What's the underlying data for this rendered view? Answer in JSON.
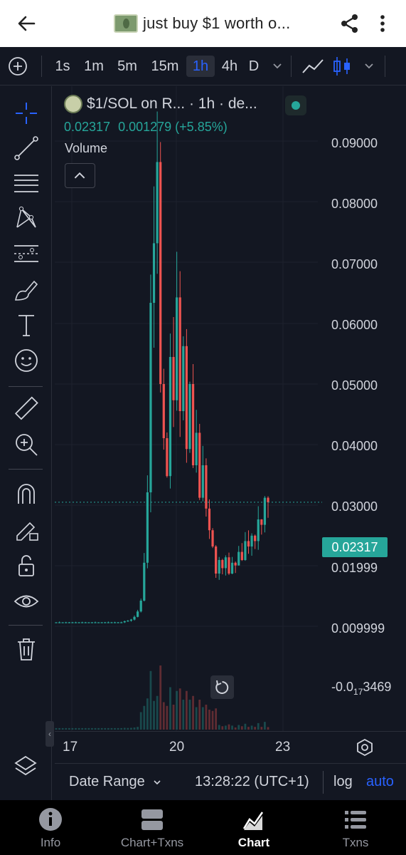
{
  "header": {
    "title": "just buy $1 worth o...",
    "back_icon": "arrow-left-icon",
    "share_icon": "share-icon",
    "menu_icon": "more-vertical-icon"
  },
  "toolbar": {
    "intervals": [
      "1s",
      "1m",
      "5m",
      "15m",
      "1h",
      "4h",
      "D"
    ],
    "active_interval": "1h"
  },
  "legend": {
    "symbol": "$1/SOL on R... · 1h · de...",
    "price": "0.02317",
    "change": "0.001279 (+5.85%)",
    "volume_label": "Volume"
  },
  "price_axis": {
    "labels": [
      "0.09000",
      "0.08000",
      "0.07000",
      "0.06000",
      "0.05000",
      "0.04000",
      "0.03000",
      "0.01999",
      "0.009999"
    ],
    "last_price": "0.02317",
    "low_label_main": "-0.0",
    "low_label_sub": "17",
    "low_label_tail": "3469"
  },
  "time_axis": {
    "labels": [
      "17",
      "20",
      "23"
    ]
  },
  "bottom_bar": {
    "date_range": "Date Range",
    "time": "13:28:22 (UTC+1)",
    "log": "log",
    "auto": "auto"
  },
  "nav": {
    "items": [
      {
        "label": "Info",
        "icon": "info-icon"
      },
      {
        "label": "Chart+Txns",
        "icon": "split-icon"
      },
      {
        "label": "Chart",
        "icon": "chart-icon"
      },
      {
        "label": "Txns",
        "icon": "list-icon"
      }
    ],
    "active": "Chart"
  },
  "colors": {
    "up": "#26a69a",
    "down": "#ef5350",
    "accent": "#2962ff",
    "background": "#131722"
  },
  "chart_data": {
    "type": "candlestick",
    "ylim": [
      0.0,
      0.09
    ],
    "x_ticks": [
      "17",
      "20",
      "23"
    ],
    "last": 0.02317,
    "close_series": [
      0.001,
      0.001,
      0.001,
      0.001,
      0.001,
      0.001,
      0.001,
      0.001,
      0.001,
      0.001,
      0.001,
      0.001,
      0.001,
      0.001,
      0.001,
      0.001,
      0.001,
      0.001,
      0.001,
      0.001,
      0.001,
      0.0012,
      0.0013,
      0.0015,
      0.002,
      0.003,
      0.005,
      0.012,
      0.025,
      0.06,
      0.071,
      0.086,
      0.045,
      0.035,
      0.028,
      0.05,
      0.042,
      0.061,
      0.04,
      0.052,
      0.033,
      0.045,
      0.03,
      0.036,
      0.024,
      0.03,
      0.022,
      0.018,
      0.015,
      0.01,
      0.0125,
      0.011,
      0.013,
      0.01,
      0.012,
      0.0115,
      0.014,
      0.0125,
      0.016,
      0.015,
      0.017,
      0.016,
      0.02,
      0.019,
      0.024,
      0.02317
    ]
  }
}
